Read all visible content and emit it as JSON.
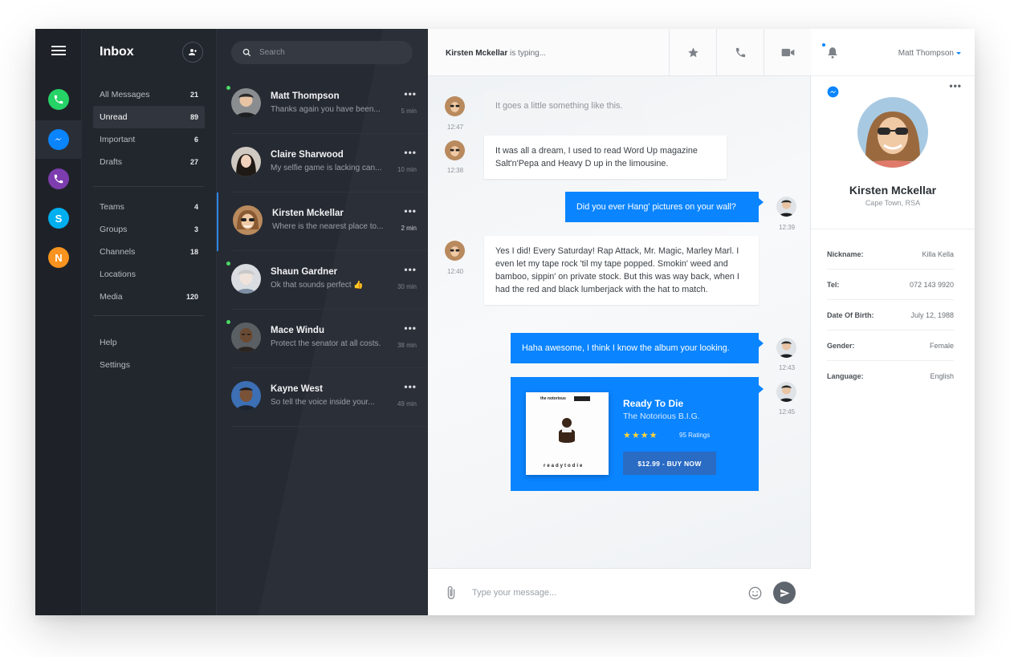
{
  "colors": {
    "accent": "#0a84ff",
    "online": "#4cd964",
    "whatsapp": "#25d366",
    "messenger": "#0a84ff",
    "viber": "#7d3daf",
    "skype": "#00aff0",
    "n_app": "#f7931e"
  },
  "rail": {
    "apps": [
      {
        "name": "whatsapp",
        "icon": "whatsapp-icon"
      },
      {
        "name": "messenger",
        "icon": "messenger-icon"
      },
      {
        "name": "viber",
        "icon": "viber-icon"
      },
      {
        "name": "skype",
        "icon": "skype-icon",
        "letter": "S"
      },
      {
        "name": "n-app",
        "icon": "n-app-icon",
        "letter": "N"
      }
    ]
  },
  "folders": {
    "title": "Inbox",
    "group1": [
      {
        "label": "All Messages",
        "count": "21"
      },
      {
        "label": "Unread",
        "count": "89"
      },
      {
        "label": "Important",
        "count": "6"
      },
      {
        "label": "Drafts",
        "count": "27"
      }
    ],
    "group2": [
      {
        "label": "Teams",
        "count": "4"
      },
      {
        "label": "Groups",
        "count": "3"
      },
      {
        "label": "Channels",
        "count": "18"
      },
      {
        "label": "Locations",
        "count": ""
      },
      {
        "label": "Media",
        "count": "120"
      }
    ],
    "group3": [
      {
        "label": "Help"
      },
      {
        "label": "Settings"
      }
    ]
  },
  "search": {
    "placeholder": "Search"
  },
  "conversations": [
    {
      "name": "Matt Thompson",
      "preview": "Thanks again you have been...",
      "time": "5 min",
      "online": true,
      "more": "•••"
    },
    {
      "name": "Claire Sharwood",
      "preview": "My selfie game is lacking can...",
      "time": "10 min",
      "online": false,
      "more": "•••"
    },
    {
      "name": "Kirsten Mckellar",
      "preview": "Where is the nearest place to...",
      "time": "2 min",
      "online": false,
      "more": "•••"
    },
    {
      "name": "Shaun Gardner",
      "preview": "Ok that sounds perfect 👍",
      "time": "30 min",
      "online": true,
      "more": "•••"
    },
    {
      "name": "Mace Windu",
      "preview": "Protect the senator at all costs.",
      "time": "38 min",
      "online": true,
      "more": "•••"
    },
    {
      "name": "Kayne West",
      "preview": "So tell the voice inside your...",
      "time": "49 min",
      "online": false,
      "more": "•••"
    }
  ],
  "chat": {
    "typing_name": "Kirsten Mckellar",
    "typing_suffix": " is typing...",
    "messages": [
      {
        "dir": "in",
        "text": "It goes a little something like this.",
        "time": "12:47"
      },
      {
        "dir": "in",
        "text": "It was all a dream, I used to read Word Up magazine Salt'n'Pepa and Heavy D up in the limousine.",
        "time": "12:38"
      },
      {
        "dir": "out",
        "text": "Did you ever Hang' pictures on your wall?",
        "time": "12:39"
      },
      {
        "dir": "in",
        "text": "Yes I did! Every Saturday! Rap Attack, Mr. Magic, Marley Marl. I even let my tape rock 'til my tape popped. Smokin' weed and bamboo, sippin' on private stock.  But this was way back, when I had the red and black lumberjack with the hat to match.",
        "time": "12:40"
      },
      {
        "dir": "out",
        "text": "Haha awesome,  I think I know the album your looking.",
        "time": "12:43"
      }
    ],
    "album": {
      "title": "Ready To Die",
      "artist": "The Notorious B.I.G.",
      "stars": "★★★★",
      "ratings": "95 Ratings",
      "buy_label": "$12.99  -  BUY NOW",
      "cover_band": "the notorious",
      "cover_tagline": "readytodie",
      "time": "12:45"
    },
    "composer_placeholder": "Type your message..."
  },
  "profile": {
    "user": "Matt Thompson",
    "name": "Kirsten Mckellar",
    "location": "Cape Town, RSA",
    "more": "•••",
    "details": [
      {
        "key": "Nickname:",
        "value": "Killa Kella"
      },
      {
        "key": "Tel:",
        "value": "072 143 9920"
      },
      {
        "key": "Date Of Birth:",
        "value": "July 12, 1988"
      },
      {
        "key": "Gender:",
        "value": "Female"
      },
      {
        "key": "Language:",
        "value": "English"
      }
    ]
  }
}
